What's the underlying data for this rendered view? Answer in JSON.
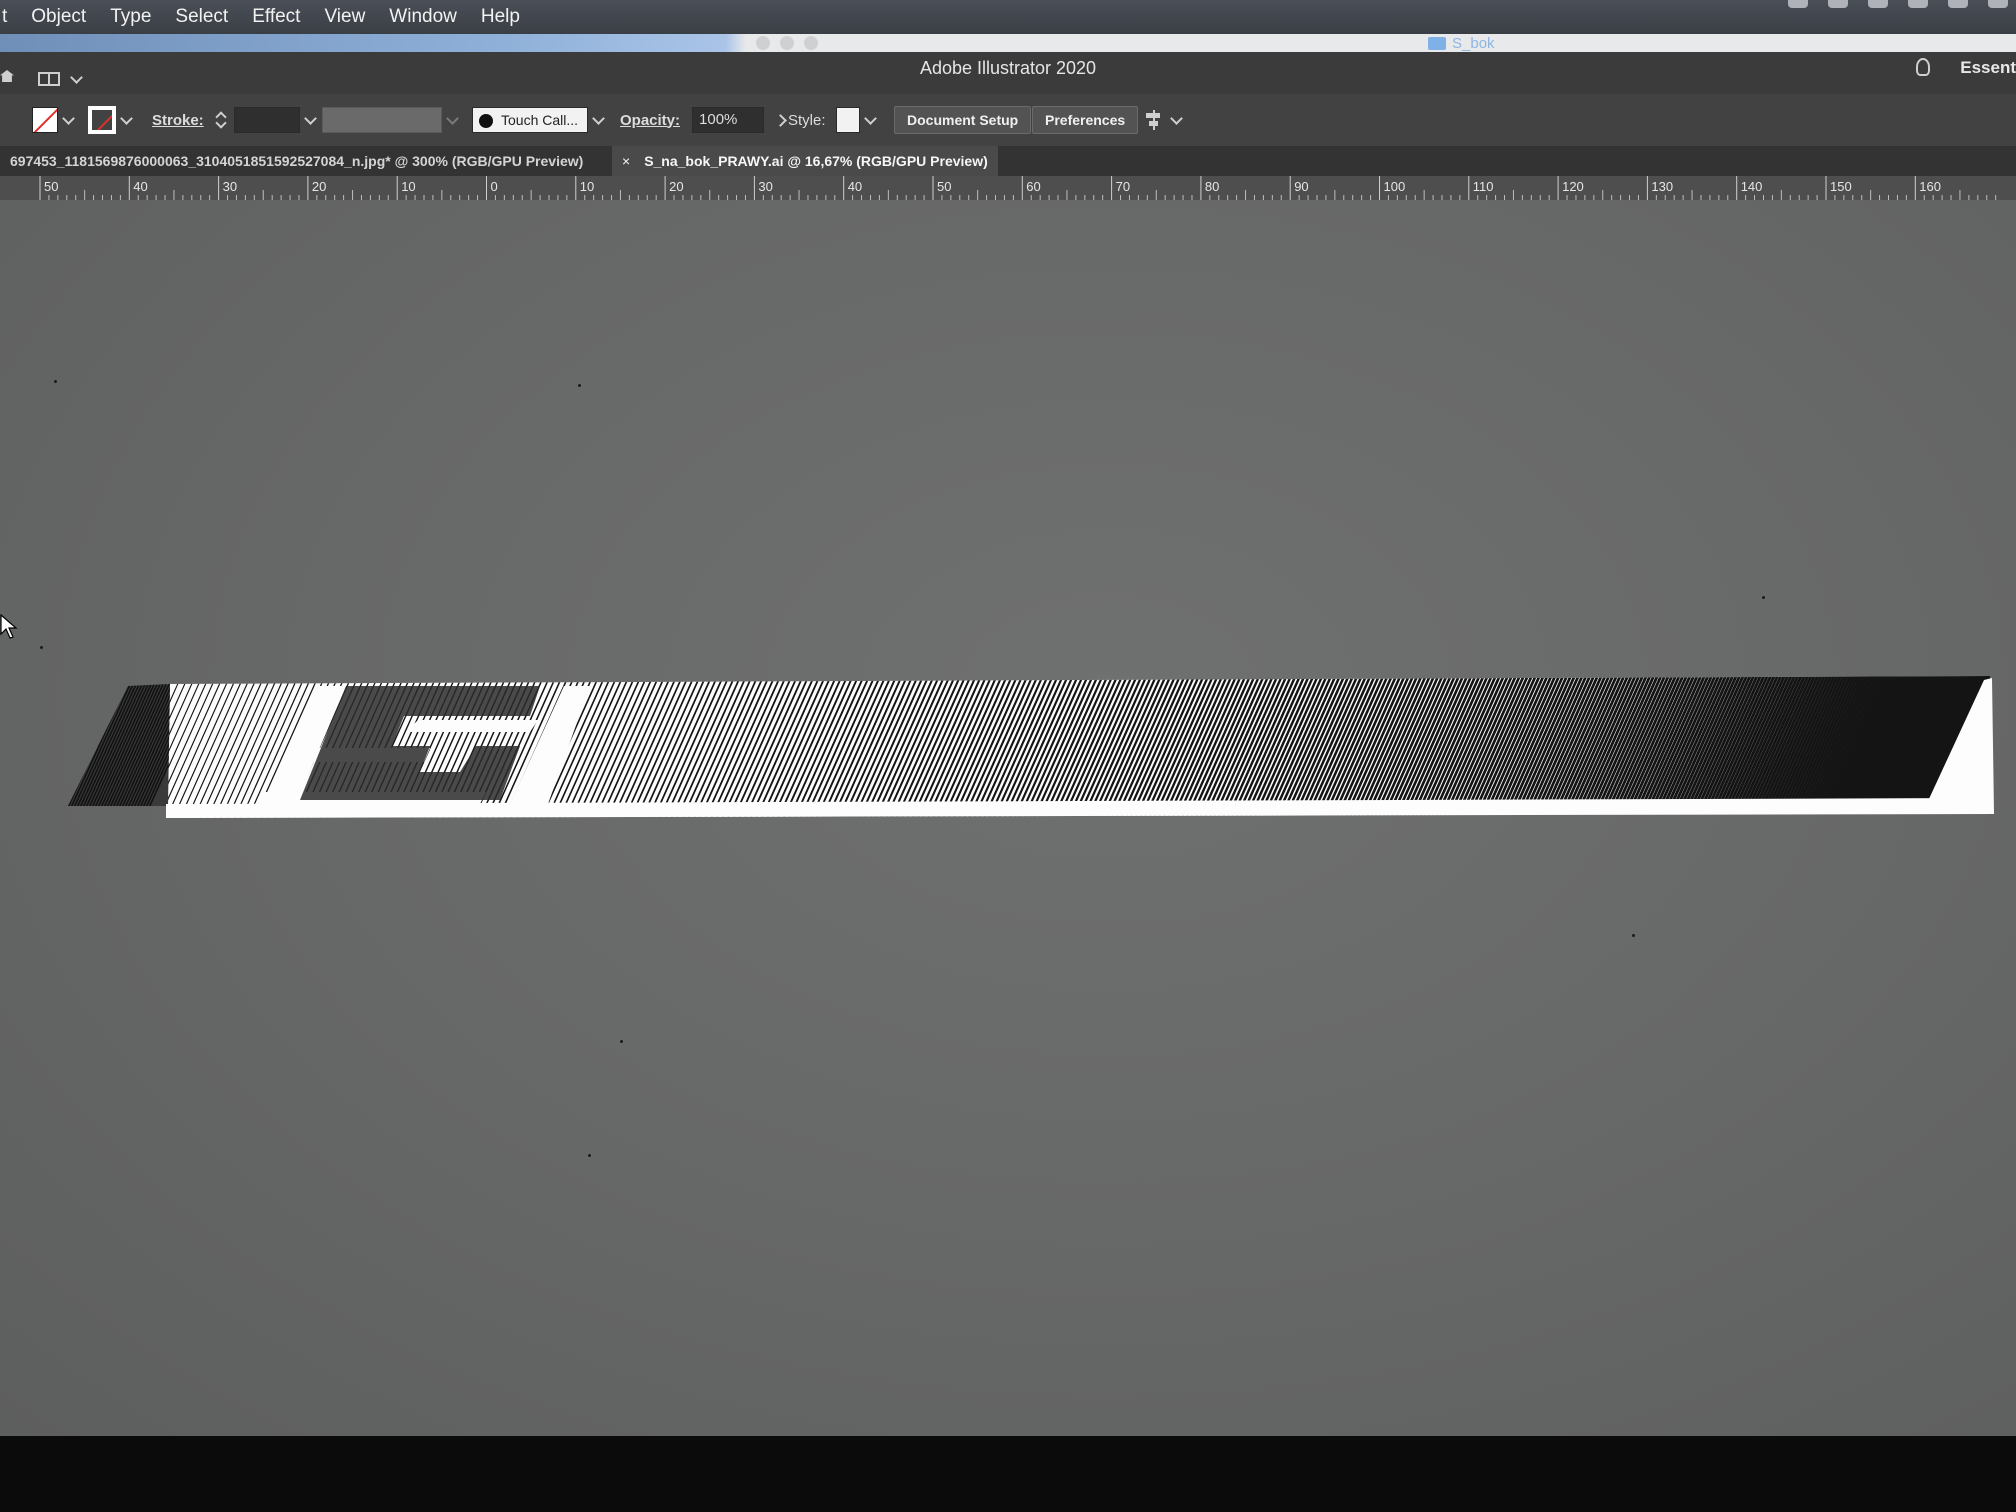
{
  "menubar": {
    "items": [
      "t",
      "Object",
      "Type",
      "Select",
      "Effect",
      "View",
      "Window",
      "Help"
    ]
  },
  "finder_strip": {
    "folder_name": "S_bok"
  },
  "titlebar": {
    "title": "Adobe Illustrator 2020",
    "workspace_label": "Essent"
  },
  "controlbar": {
    "stroke_label": "Stroke:",
    "brush_name": "Touch Call...",
    "opacity_label": "Opacity:",
    "opacity_value": "100%",
    "style_label": "Style:",
    "document_setup_button": "Document Setup",
    "preferences_button": "Preferences"
  },
  "tabs": [
    {
      "label": "697453_1181569876000063_3104051851592527084_n.jpg* @ 300% (RGB/GPU Preview)",
      "active": false
    },
    {
      "label": "S_na_bok_PRAWY.ai @ 16,67% (RGB/GPU Preview)",
      "active": true,
      "close": "×"
    }
  ],
  "ruler": {
    "labels": [
      "50",
      "40",
      "30",
      "20",
      "10",
      "0",
      "10",
      "20",
      "30",
      "40",
      "50",
      "60",
      "70",
      "80",
      "90",
      "100",
      "110",
      "120",
      "130",
      "140",
      "150",
      "160"
    ]
  },
  "colors": {
    "canvas": "#686969",
    "panel": "#424242",
    "artwork_dark": "#111111",
    "artwork_light": "#ffffff"
  },
  "icons": [
    "home-icon",
    "workspace-layout-icon",
    "lightbulb-icon",
    "fill-swatch-icon",
    "stroke-swatch-icon",
    "brush-dot-icon",
    "align-icon",
    "arrow-cursor-icon",
    "folder-icon"
  ]
}
